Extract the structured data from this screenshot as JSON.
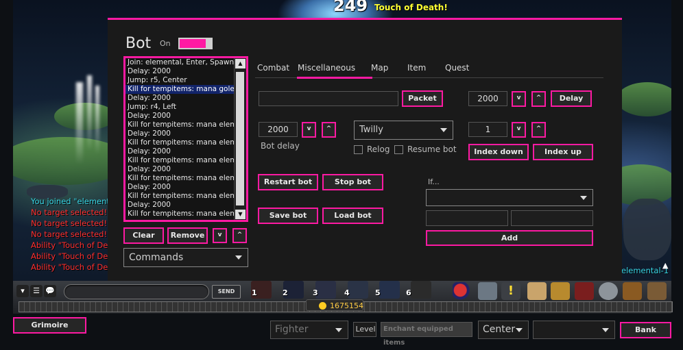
{
  "game": {
    "damage_number": "249",
    "damage_message": "Touch of Death!",
    "player_name": "elemental-1",
    "chat_log": [
      {
        "text": "You joined \"element",
        "color": "cyan"
      },
      {
        "text": "No target selected!",
        "color": "red"
      },
      {
        "text": "No target selected!",
        "color": "red"
      },
      {
        "text": "No target selected!",
        "color": "red"
      },
      {
        "text": "Ability \"Touch of Dea",
        "color": "red"
      },
      {
        "text": "Ability \"Touch of Dea",
        "color": "red"
      },
      {
        "text": "Ability \"Touch of Dea",
        "color": "red"
      }
    ],
    "chat_send_label": "SEND",
    "skill_numbers": [
      "1",
      "2",
      "3",
      "4",
      "5",
      "6"
    ],
    "gold": "1675154"
  },
  "bot": {
    "title": "Bot",
    "on_label": "On",
    "toggle_on": true,
    "commands": [
      "Join: elemental, Enter, Spawn",
      "Delay: 2000",
      "Jump: r5, Center",
      "Kill for tempitems: mana golem",
      "Delay: 2000",
      "Jump: r4, Left",
      "Delay: 2000",
      "Kill for tempitems: mana eleme",
      "Delay: 2000",
      "Kill for tempitems: mana eleme",
      "Delay: 2000",
      "Kill for tempitems: mana eleme",
      "Delay: 2000",
      "Kill for tempitems: mana eleme",
      "Delay: 2000",
      "Kill for tempitems: mana eleme",
      "Delay: 2000",
      "Kill for tempitems: mana eleme"
    ],
    "selected_index": 3,
    "clear_label": "Clear",
    "remove_label": "Remove",
    "move_down_label": "v",
    "move_up_label": "^",
    "commands_dropdown": "Commands",
    "tabs": [
      "Combat",
      "Miscellaneous",
      "Map",
      "Item",
      "Quest"
    ],
    "active_tab": "Miscellaneous",
    "packet_input": "",
    "packet_label": "Packet",
    "delay_value": "2000",
    "delay_label": "Delay",
    "bot_delay_value": "2000",
    "bot_delay_label": "Bot delay",
    "bot_select": "Twilly",
    "relog_label": "Relog",
    "resume_bot_label": "Resume bot",
    "index_value": "1",
    "index_down_label": "Index down",
    "index_up_label": "Index up",
    "restart_bot_label": "Restart bot",
    "stop_bot_label": "Stop bot",
    "save_bot_label": "Save bot",
    "load_bot_label": "Load bot",
    "if_label": "If...",
    "if_select": "",
    "if_input_1": "",
    "if_input_2": "",
    "add_label": "Add",
    "spinner_down": "v",
    "spinner_up": "^"
  },
  "toolbar": {
    "grimoire_label": "Grimoire",
    "class_select": "Fighter",
    "level_label": "Level",
    "enchant_label": "Enchant equipped items",
    "position_select": "Center",
    "extra_select": "",
    "bank_label": "Bank"
  },
  "colors": {
    "accent": "#ff1aa3",
    "window_bg": "#1a1a1a",
    "selection": "#12246a"
  }
}
